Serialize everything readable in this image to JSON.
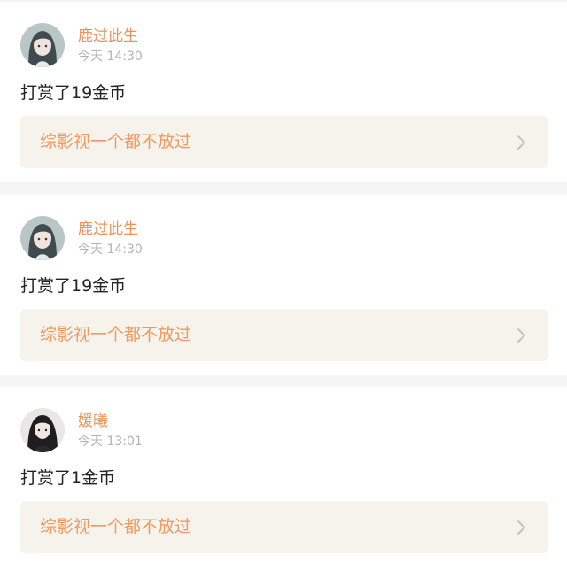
{
  "posts": [
    {
      "user": {
        "name": "鹿过此生",
        "avatar": "long-dark-hair-anime-avatar"
      },
      "time": "今天 14:30",
      "message": "打赏了19金币",
      "book": {
        "title": "综影视一个都不放过",
        "icon": "chevron-right-icon"
      }
    },
    {
      "user": {
        "name": "鹿过此生",
        "avatar": "long-dark-hair-anime-avatar"
      },
      "time": "今天 14:30",
      "message": "打赏了19金币",
      "book": {
        "title": "综影视一个都不放过",
        "icon": "chevron-right-icon"
      }
    },
    {
      "user": {
        "name": "媛曦",
        "avatar": "dark-hair-portrait-avatar"
      },
      "time": "今天 13:01",
      "message": "打赏了1金币",
      "book": {
        "title": "综影视一个都不放过",
        "icon": "chevron-right-icon"
      }
    }
  ],
  "colors": {
    "page_background": "#f6f5f5",
    "card_background": "#ffffff",
    "username": "#e8945a",
    "timestamp": "#b3b3b3",
    "message": "#222222",
    "book_link_background": "#f5f3ec",
    "book_title": "#ee9a60",
    "chevron": "#c4c4c4"
  }
}
